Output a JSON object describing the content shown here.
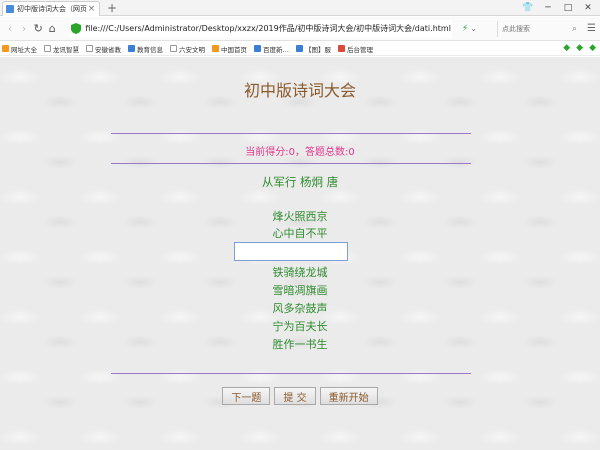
{
  "browser": {
    "tab_title": "初中版诗词大会（网页版）",
    "address": "file:///C:/Users/Administrator/Desktop/xxzx/2019作品/初中版诗词大会/初中版诗词大会/dati.html",
    "search_placeholder": "点此搜索",
    "bookmarks": [
      {
        "label": "网址大全",
        "icon": "orange"
      },
      {
        "label": "龙讯智慧",
        "icon": "doc"
      },
      {
        "label": "安徽省教",
        "icon": "doc"
      },
      {
        "label": "教育信息",
        "icon": "blue"
      },
      {
        "label": "六安文明",
        "icon": "doc"
      },
      {
        "label": "中国首页",
        "icon": "orange"
      },
      {
        "label": "百度新…",
        "icon": "blue"
      },
      {
        "label": "【图】服",
        "icon": "blue"
      },
      {
        "label": "后台管理",
        "icon": "red"
      }
    ]
  },
  "page": {
    "title": "初中版诗词大会",
    "score_text": "当前得分:0，答题总数:0",
    "poem_title": "从军行 杨炯 唐",
    "lines_before": [
      "烽火照西京",
      "心中自不平"
    ],
    "answer_value": "",
    "lines_after": [
      "铁骑绕龙城",
      "雪暗凋旗画",
      "风多杂鼓声",
      "宁为百夫长",
      "胜作一书生"
    ],
    "buttons": {
      "next": "下一题",
      "submit": "提  交",
      "restart": "重新开始"
    }
  }
}
